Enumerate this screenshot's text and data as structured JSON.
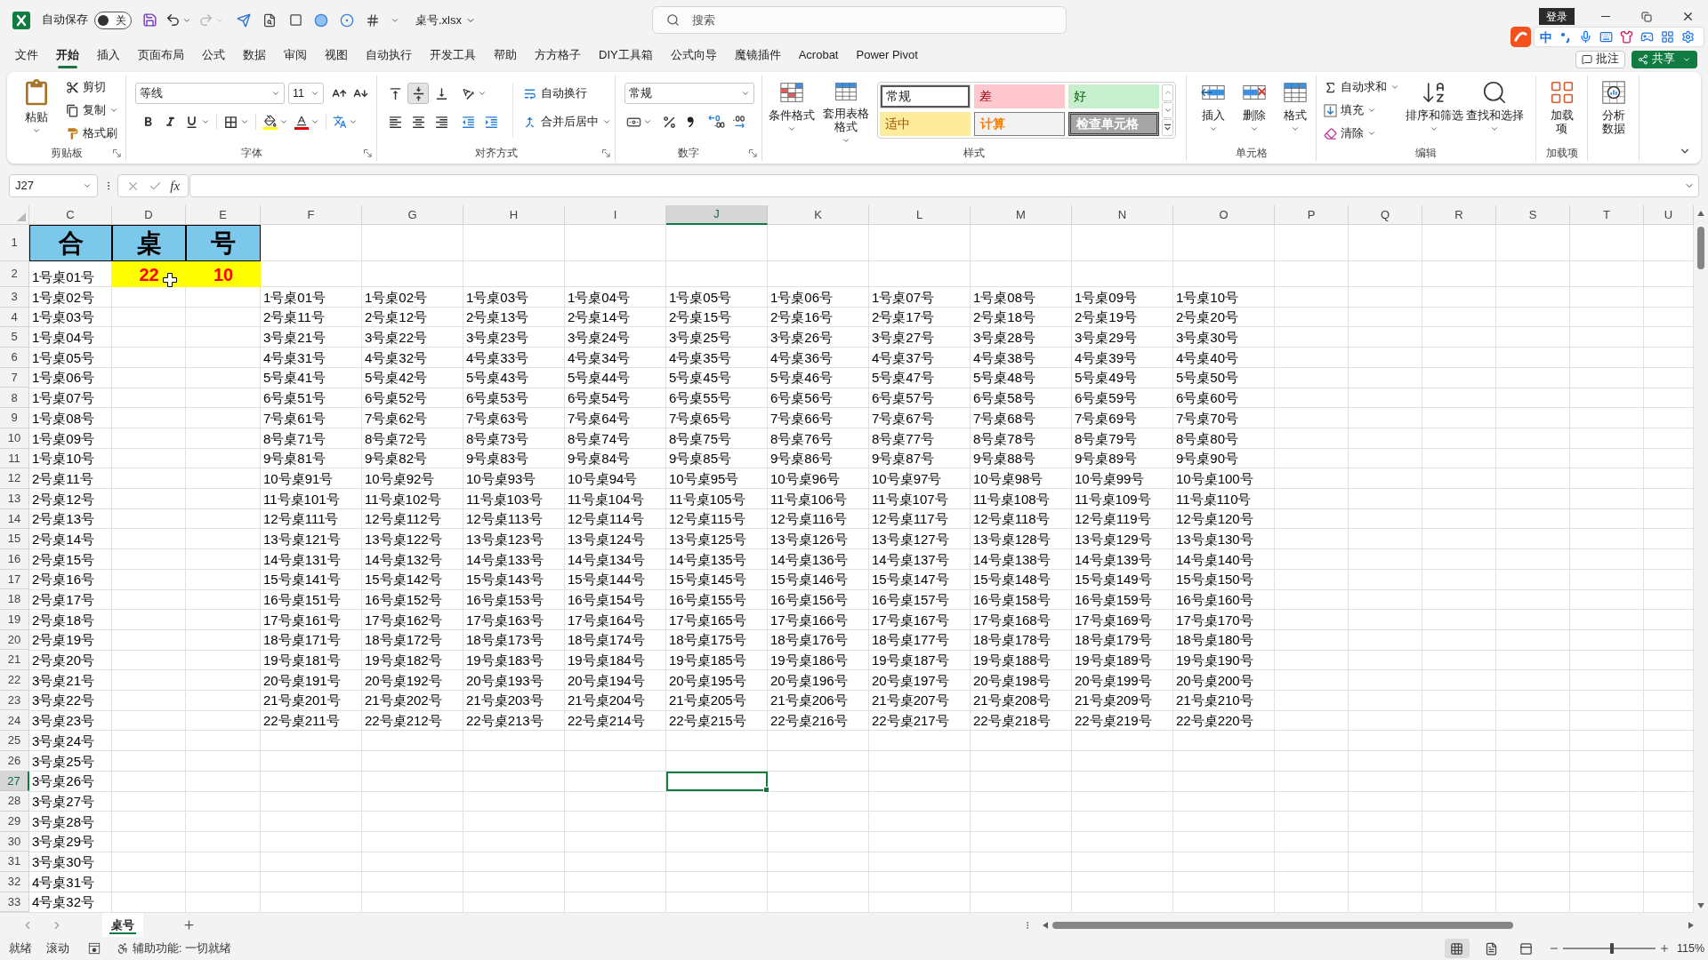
{
  "title_bar": {
    "autosave_label": "自动保存",
    "autosave": {
      "on": false,
      "label": "关"
    },
    "undo": {
      "disabled": false
    },
    "redo": {
      "disabled": true
    },
    "file_name": "桌号.xlsx",
    "search": {
      "placeholder": "搜索"
    },
    "login": "登录"
  },
  "ime_toolbar": {
    "mode": "中"
  },
  "menu_tabs": [
    {
      "label": "文件",
      "selected": false
    },
    {
      "label": "开始",
      "selected": true
    },
    {
      "label": "插入",
      "selected": false
    },
    {
      "label": "页面布局",
      "selected": false
    },
    {
      "label": "公式",
      "selected": false
    },
    {
      "label": "数据",
      "selected": false
    },
    {
      "label": "审阅",
      "selected": false
    },
    {
      "label": "视图",
      "selected": false
    },
    {
      "label": "自动执行",
      "selected": false
    },
    {
      "label": "开发工具",
      "selected": false
    },
    {
      "label": "帮助",
      "selected": false
    },
    {
      "label": "方方格子",
      "selected": false
    },
    {
      "label": "DIY工具箱",
      "selected": false
    },
    {
      "label": "公式向导",
      "selected": false
    },
    {
      "label": "魔镜插件",
      "selected": false
    },
    {
      "label": "Acrobat",
      "selected": false
    },
    {
      "label": "Power Pivot",
      "selected": false
    }
  ],
  "menu_actions": {
    "comments": "批注",
    "share": "共享"
  },
  "ribbon": {
    "clipboard": {
      "label": "剪贴板",
      "paste": "粘贴",
      "cut": "剪切",
      "copy": "复制",
      "format_painter": "格式刷"
    },
    "font": {
      "label": "字体",
      "font_name": "等线",
      "font_size": "11"
    },
    "alignment": {
      "label": "对齐方式",
      "vertical_align": [
        {
          "kind": "top",
          "selected": false
        },
        {
          "kind": "middle",
          "selected": true
        },
        {
          "kind": "bottom",
          "selected": false
        }
      ],
      "wrap_text": "自动换行",
      "merge_center": "合并后居中"
    },
    "number": {
      "label": "数字",
      "format": "常规"
    },
    "styles": {
      "label": "样式",
      "conditional_formatting": "条件格式",
      "format_as_table": "套用表格格式",
      "cell_styles": [
        {
          "text": "常规",
          "kind": "normal",
          "selected": true
        },
        {
          "text": "差",
          "kind": "bad",
          "selected": false
        },
        {
          "text": "好",
          "kind": "good",
          "selected": false
        },
        {
          "text": "适中",
          "kind": "neutral",
          "selected": false
        },
        {
          "text": "计算",
          "kind": "calculation",
          "selected": false
        },
        {
          "text": "检查单元格",
          "kind": "check",
          "selected": false
        }
      ]
    },
    "cells": {
      "label": "单元格",
      "insert": "插入",
      "delete": "删除",
      "format": "格式"
    },
    "editing": {
      "label": "编辑",
      "autosum": "自动求和",
      "fill": "填充",
      "clear": "清除",
      "sort_filter": "排序和筛选",
      "find_select": "查找和选择"
    },
    "addins": {
      "label": "加载项",
      "button": "加载项"
    },
    "analyze": {
      "button": "分析数据"
    }
  },
  "formula_bar": {
    "name_box": "J27",
    "function_label": "fx"
  },
  "sheet": {
    "columns": [
      {
        "label": "C",
        "selected": false
      },
      {
        "label": "D",
        "selected": false
      },
      {
        "label": "E",
        "selected": false
      },
      {
        "label": "F",
        "selected": false
      },
      {
        "label": "G",
        "selected": false
      },
      {
        "label": "H",
        "selected": false
      },
      {
        "label": "I",
        "selected": false
      },
      {
        "label": "J",
        "selected": true
      },
      {
        "label": "K",
        "selected": false
      },
      {
        "label": "L",
        "selected": false
      },
      {
        "label": "M",
        "selected": false
      },
      {
        "label": "N",
        "selected": false
      },
      {
        "label": "O",
        "selected": false
      },
      {
        "label": "P",
        "selected": false
      },
      {
        "label": "Q",
        "selected": false
      },
      {
        "label": "R",
        "selected": false
      },
      {
        "label": "S",
        "selected": false
      },
      {
        "label": "T",
        "selected": false
      },
      {
        "label": "U",
        "selected": false
      }
    ],
    "rows": [
      {
        "number": "1",
        "selected": false,
        "cells": [
          {
            "kind": "title",
            "text": "合"
          },
          {
            "kind": "title",
            "text": "桌"
          },
          {
            "kind": "title",
            "text": "号"
          }
        ]
      },
      {
        "number": "2",
        "selected": false,
        "cells": [
          {
            "kind": "plain",
            "text": "1号桌01号"
          },
          {
            "kind": "input",
            "text": "22"
          },
          {
            "kind": "input",
            "text": "10"
          }
        ]
      },
      {
        "number": "3",
        "selected": false,
        "cells": [
          {
            "kind": "plain",
            "text": "1号桌02号"
          }
        ],
        "block": [
          "1号桌01号",
          "1号桌02号",
          "1号桌03号",
          "1号桌04号",
          "1号桌05号",
          "1号桌06号",
          "1号桌07号",
          "1号桌08号",
          "1号桌09号",
          "1号桌10号"
        ]
      },
      {
        "number": "4",
        "selected": false,
        "cells": [
          {
            "kind": "plain",
            "text": "1号桌03号"
          }
        ],
        "block": [
          "2号桌11号",
          "2号桌12号",
          "2号桌13号",
          "2号桌14号",
          "2号桌15号",
          "2号桌16号",
          "2号桌17号",
          "2号桌18号",
          "2号桌19号",
          "2号桌20号"
        ]
      },
      {
        "number": "5",
        "selected": false,
        "cells": [
          {
            "kind": "plain",
            "text": "1号桌04号"
          }
        ],
        "block": [
          "3号桌21号",
          "3号桌22号",
          "3号桌23号",
          "3号桌24号",
          "3号桌25号",
          "3号桌26号",
          "3号桌27号",
          "3号桌28号",
          "3号桌29号",
          "3号桌30号"
        ]
      },
      {
        "number": "6",
        "selected": false,
        "cells": [
          {
            "kind": "plain",
            "text": "1号桌05号"
          }
        ],
        "block": [
          "4号桌31号",
          "4号桌32号",
          "4号桌33号",
          "4号桌34号",
          "4号桌35号",
          "4号桌36号",
          "4号桌37号",
          "4号桌38号",
          "4号桌39号",
          "4号桌40号"
        ]
      },
      {
        "number": "7",
        "selected": false,
        "cells": [
          {
            "kind": "plain",
            "text": "1号桌06号"
          }
        ],
        "block": [
          "5号桌41号",
          "5号桌42号",
          "5号桌43号",
          "5号桌44号",
          "5号桌45号",
          "5号桌46号",
          "5号桌47号",
          "5号桌48号",
          "5号桌49号",
          "5号桌50号"
        ]
      },
      {
        "number": "8",
        "selected": false,
        "cells": [
          {
            "kind": "plain",
            "text": "1号桌07号"
          }
        ],
        "block": [
          "6号桌51号",
          "6号桌52号",
          "6号桌53号",
          "6号桌54号",
          "6号桌55号",
          "6号桌56号",
          "6号桌57号",
          "6号桌58号",
          "6号桌59号",
          "6号桌60号"
        ]
      },
      {
        "number": "9",
        "selected": false,
        "cells": [
          {
            "kind": "plain",
            "text": "1号桌08号"
          }
        ],
        "block": [
          "7号桌61号",
          "7号桌62号",
          "7号桌63号",
          "7号桌64号",
          "7号桌65号",
          "7号桌66号",
          "7号桌67号",
          "7号桌68号",
          "7号桌69号",
          "7号桌70号"
        ]
      },
      {
        "number": "10",
        "selected": false,
        "cells": [
          {
            "kind": "plain",
            "text": "1号桌09号"
          }
        ],
        "block": [
          "8号桌71号",
          "8号桌72号",
          "8号桌73号",
          "8号桌74号",
          "8号桌75号",
          "8号桌76号",
          "8号桌77号",
          "8号桌78号",
          "8号桌79号",
          "8号桌80号"
        ]
      },
      {
        "number": "11",
        "selected": false,
        "cells": [
          {
            "kind": "plain",
            "text": "1号桌10号"
          }
        ],
        "block": [
          "9号桌81号",
          "9号桌82号",
          "9号桌83号",
          "9号桌84号",
          "9号桌85号",
          "9号桌86号",
          "9号桌87号",
          "9号桌88号",
          "9号桌89号",
          "9号桌90号"
        ]
      },
      {
        "number": "12",
        "selected": false,
        "cells": [
          {
            "kind": "plain",
            "text": "2号桌11号"
          }
        ],
        "block": [
          "10号桌91号",
          "10号桌92号",
          "10号桌93号",
          "10号桌94号",
          "10号桌95号",
          "10号桌96号",
          "10号桌97号",
          "10号桌98号",
          "10号桌99号",
          "10号桌100号"
        ]
      },
      {
        "number": "13",
        "selected": false,
        "cells": [
          {
            "kind": "plain",
            "text": "2号桌12号"
          }
        ],
        "block": [
          "11号桌101号",
          "11号桌102号",
          "11号桌103号",
          "11号桌104号",
          "11号桌105号",
          "11号桌106号",
          "11号桌107号",
          "11号桌108号",
          "11号桌109号",
          "11号桌110号"
        ]
      },
      {
        "number": "14",
        "selected": false,
        "cells": [
          {
            "kind": "plain",
            "text": "2号桌13号"
          }
        ],
        "block": [
          "12号桌111号",
          "12号桌112号",
          "12号桌113号",
          "12号桌114号",
          "12号桌115号",
          "12号桌116号",
          "12号桌117号",
          "12号桌118号",
          "12号桌119号",
          "12号桌120号"
        ]
      },
      {
        "number": "15",
        "selected": false,
        "cells": [
          {
            "kind": "plain",
            "text": "2号桌14号"
          }
        ],
        "block": [
          "13号桌121号",
          "13号桌122号",
          "13号桌123号",
          "13号桌124号",
          "13号桌125号",
          "13号桌126号",
          "13号桌127号",
          "13号桌128号",
          "13号桌129号",
          "13号桌130号"
        ]
      },
      {
        "number": "16",
        "selected": false,
        "cells": [
          {
            "kind": "plain",
            "text": "2号桌15号"
          }
        ],
        "block": [
          "14号桌131号",
          "14号桌132号",
          "14号桌133号",
          "14号桌134号",
          "14号桌135号",
          "14号桌136号",
          "14号桌137号",
          "14号桌138号",
          "14号桌139号",
          "14号桌140号"
        ]
      },
      {
        "number": "17",
        "selected": false,
        "cells": [
          {
            "kind": "plain",
            "text": "2号桌16号"
          }
        ],
        "block": [
          "15号桌141号",
          "15号桌142号",
          "15号桌143号",
          "15号桌144号",
          "15号桌145号",
          "15号桌146号",
          "15号桌147号",
          "15号桌148号",
          "15号桌149号",
          "15号桌150号"
        ]
      },
      {
        "number": "18",
        "selected": false,
        "cells": [
          {
            "kind": "plain",
            "text": "2号桌17号"
          }
        ],
        "block": [
          "16号桌151号",
          "16号桌152号",
          "16号桌153号",
          "16号桌154号",
          "16号桌155号",
          "16号桌156号",
          "16号桌157号",
          "16号桌158号",
          "16号桌159号",
          "16号桌160号"
        ]
      },
      {
        "number": "19",
        "selected": false,
        "cells": [
          {
            "kind": "plain",
            "text": "2号桌18号"
          }
        ],
        "block": [
          "17号桌161号",
          "17号桌162号",
          "17号桌163号",
          "17号桌164号",
          "17号桌165号",
          "17号桌166号",
          "17号桌167号",
          "17号桌168号",
          "17号桌169号",
          "17号桌170号"
        ]
      },
      {
        "number": "20",
        "selected": false,
        "cells": [
          {
            "kind": "plain",
            "text": "2号桌19号"
          }
        ],
        "block": [
          "18号桌171号",
          "18号桌172号",
          "18号桌173号",
          "18号桌174号",
          "18号桌175号",
          "18号桌176号",
          "18号桌177号",
          "18号桌178号",
          "18号桌179号",
          "18号桌180号"
        ]
      },
      {
        "number": "21",
        "selected": false,
        "cells": [
          {
            "kind": "plain",
            "text": "2号桌20号"
          }
        ],
        "block": [
          "19号桌181号",
          "19号桌182号",
          "19号桌183号",
          "19号桌184号",
          "19号桌185号",
          "19号桌186号",
          "19号桌187号",
          "19号桌188号",
          "19号桌189号",
          "19号桌190号"
        ]
      },
      {
        "number": "22",
        "selected": false,
        "cells": [
          {
            "kind": "plain",
            "text": "3号桌21号"
          }
        ],
        "block": [
          "20号桌191号",
          "20号桌192号",
          "20号桌193号",
          "20号桌194号",
          "20号桌195号",
          "20号桌196号",
          "20号桌197号",
          "20号桌198号",
          "20号桌199号",
          "20号桌200号"
        ]
      },
      {
        "number": "23",
        "selected": false,
        "cells": [
          {
            "kind": "plain",
            "text": "3号桌22号"
          }
        ],
        "block": [
          "21号桌201号",
          "21号桌202号",
          "21号桌203号",
          "21号桌204号",
          "21号桌205号",
          "21号桌206号",
          "21号桌207号",
          "21号桌208号",
          "21号桌209号",
          "21号桌210号"
        ]
      },
      {
        "number": "24",
        "selected": false,
        "cells": [
          {
            "kind": "plain",
            "text": "3号桌23号"
          }
        ],
        "block": [
          "22号桌211号",
          "22号桌212号",
          "22号桌213号",
          "22号桌214号",
          "22号桌215号",
          "22号桌216号",
          "22号桌217号",
          "22号桌218号",
          "22号桌219号",
          "22号桌220号"
        ]
      },
      {
        "number": "25",
        "selected": false,
        "cells": [
          {
            "kind": "plain",
            "text": "3号桌24号"
          }
        ]
      },
      {
        "number": "26",
        "selected": false,
        "cells": [
          {
            "kind": "plain",
            "text": "3号桌25号"
          }
        ]
      },
      {
        "number": "27",
        "selected": true,
        "cells": [
          {
            "kind": "plain",
            "text": "3号桌26号"
          }
        ]
      },
      {
        "number": "28",
        "selected": false,
        "cells": [
          {
            "kind": "plain",
            "text": "3号桌27号"
          }
        ]
      },
      {
        "number": "29",
        "selected": false,
        "cells": [
          {
            "kind": "plain",
            "text": "3号桌28号"
          }
        ]
      },
      {
        "number": "30",
        "selected": false,
        "cells": [
          {
            "kind": "plain",
            "text": "3号桌29号"
          }
        ]
      },
      {
        "number": "31",
        "selected": false,
        "cells": [
          {
            "kind": "plain",
            "text": "3号桌30号"
          }
        ]
      },
      {
        "number": "32",
        "selected": false,
        "cells": [
          {
            "kind": "plain",
            "text": "4号桌31号"
          }
        ]
      },
      {
        "number": "33",
        "selected": false,
        "cells": [
          {
            "kind": "plain",
            "text": "4号桌32号"
          }
        ]
      }
    ]
  },
  "sheet_tabs": [
    {
      "label": "桌号",
      "selected": true
    }
  ],
  "status_bar": {
    "mode": "就绪",
    "scroll": "滚动",
    "accessibility": "辅助功能: 一切就绪",
    "views": [
      {
        "kind": "normal",
        "selected": true
      },
      {
        "kind": "page_layout",
        "selected": false
      },
      {
        "kind": "page_break",
        "selected": false
      }
    ],
    "zoom": {
      "level": 0.53,
      "label": "115%"
    }
  }
}
